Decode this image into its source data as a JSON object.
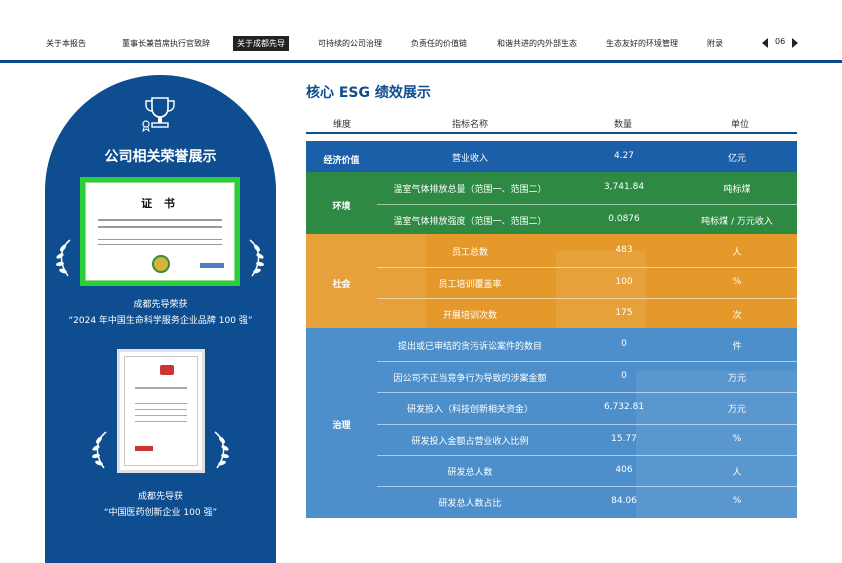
{
  "nav": {
    "items": [
      "关于本报告",
      "董事长兼首席执行官致辞",
      "关于成都先导",
      "可持续的公司治理",
      "负责任的价值链",
      "和谐共进的内外部生态",
      "生态友好的环境管理",
      "附录"
    ],
    "page": "06"
  },
  "honors": {
    "title": "公司相关荣誉展示",
    "cert1": {
      "heading": "证 书"
    },
    "award1": {
      "line1": "成都先导荣获",
      "line2": "“2024 年中国生命科学服务企业品牌 100 强”"
    },
    "award2": {
      "line1": "成都先导获",
      "line2": "“中国医药创新企业 100 强”"
    }
  },
  "section": {
    "title": "核心 ESG 绩效展示",
    "headers": {
      "dimension": "维度",
      "indicator": "指标名称",
      "value": "数量",
      "unit": "单位"
    }
  },
  "rows": [
    {
      "indicator": "营业收入",
      "value": "4.27",
      "unit": "亿元"
    },
    {
      "indicator": "温室气体排放总量（范围一、范围二）",
      "value": "3,741.84",
      "unit": "吨标煤"
    },
    {
      "indicator": "温室气体排放强度（范围一、范围二）",
      "value": "0.0876",
      "unit": "吨标煤 / 万元收入"
    },
    {
      "indicator": "员工总数",
      "value": "483",
      "unit": "人"
    },
    {
      "indicator": "员工培训覆盖率",
      "value": "100",
      "unit": "%"
    },
    {
      "indicator": "开展培训次数",
      "value": "175",
      "unit": "次"
    },
    {
      "indicator": "提出或已审结的贪污诉讼案件的数目",
      "value": "0",
      "unit": "件"
    },
    {
      "indicator": "因公司不正当竞争行为导致的涉案金额",
      "value": "0",
      "unit": "万元"
    },
    {
      "indicator": "研发投入（科技创新相关资金）",
      "value": "6,732.81",
      "unit": "万元"
    },
    {
      "indicator": "研发投入金额占营业收入比例",
      "value": "15.77",
      "unit": "%"
    },
    {
      "indicator": "研发总人数",
      "value": "406",
      "unit": "人"
    },
    {
      "indicator": "研发总人数占比",
      "value": "84.06",
      "unit": "%"
    }
  ],
  "categories": {
    "econ": "经济价值",
    "env": "环境",
    "soc": "社会",
    "gov": "治理"
  },
  "colors": {
    "primary": "#0e4d8f",
    "econ": "#1a5fa8",
    "env": "#2e8a43",
    "soc": "#e5992b",
    "gov": "#4d8fca"
  }
}
